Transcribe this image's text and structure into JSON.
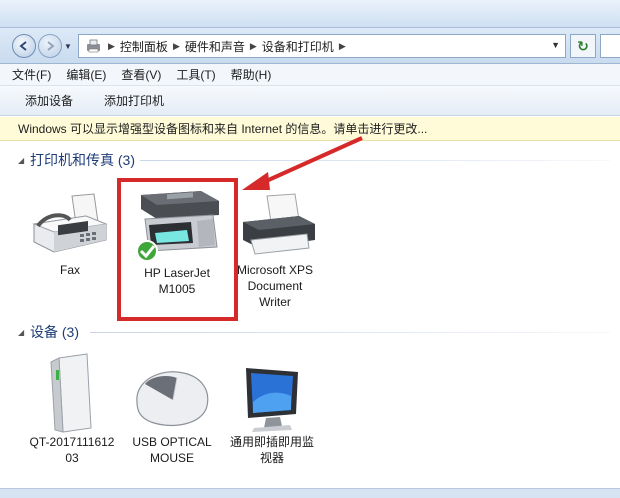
{
  "breadcrumb": {
    "items": [
      "控制面板",
      "硬件和声音",
      "设备和打印机"
    ],
    "refresh_symbol": "↻"
  },
  "menu": [
    "文件(F)",
    "编辑(E)",
    "查看(V)",
    "工具(T)",
    "帮助(H)"
  ],
  "toolbar": {
    "add_device": "添加设备",
    "add_printer": "添加打印机"
  },
  "infobar": {
    "message": "Windows 可以显示增强型设备图标和来自 Internet 的信息。请单击进行更改..."
  },
  "groups": {
    "printers": {
      "title": "打印机和传真 (3)",
      "items": [
        {
          "name": "Fax",
          "icon": "fax-icon"
        },
        {
          "name": "HP LaserJet M1005",
          "line1": "HP LaserJet",
          "line2": "M1005",
          "icon": "multifunction-printer-icon",
          "default": true
        },
        {
          "name": "Microsoft XPS Document Writer",
          "line1": "Microsoft XPS",
          "line2": "Document",
          "line3": "Writer",
          "icon": "printer-icon"
        }
      ]
    },
    "devices": {
      "title": "设备 (3)",
      "items": [
        {
          "name": "QT-2017111612 03",
          "line1": "QT-2017111612",
          "line2": "03",
          "icon": "computer-tower-icon"
        },
        {
          "name": "USB OPTICAL MOUSE",
          "line1": "USB OPTICAL",
          "line2": "MOUSE",
          "icon": "mouse-icon"
        },
        {
          "name": "通用即插即用监视器",
          "line1": "通用即插即用监",
          "line2": "视器",
          "icon": "monitor-icon"
        }
      ]
    }
  },
  "colors": {
    "highlight": "#d62a2a",
    "group_title": "#1e3c78",
    "infobar_bg": "#fffbd8"
  }
}
